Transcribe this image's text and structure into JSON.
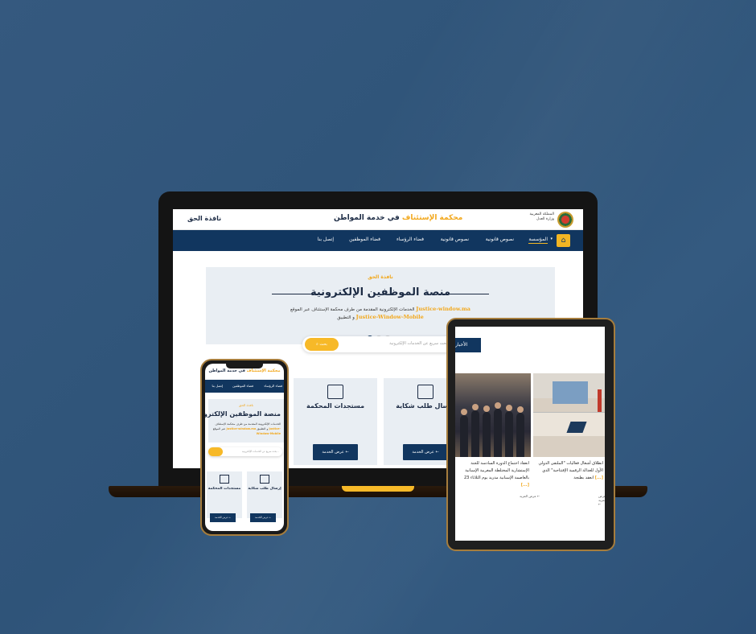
{
  "laptop": {
    "header": {
      "brand_left": "نافذة الحق",
      "brand_center_highlight": "محكمة الإستئناف",
      "brand_center_rest": " في خدمة المواطن",
      "emblem_text": "المملكة المغربية وزارة العدل"
    },
    "nav": {
      "items": [
        "المؤسسة",
        "نصوص قانونية",
        "نصوص قانونية",
        "فضاء الرؤساء",
        "فضاء الموظفين",
        "إتصل بنا"
      ]
    },
    "hero": {
      "kicker": "نافذة الحق",
      "title": "منصة الموظفين الإلكترونية",
      "desc_line1": "الخدمات الإلكترونية المقدمة من طرف محكمة الإستئناف عبر الموقع",
      "site": "Justice-window.ma",
      "desc_and": "و التطبيق",
      "app": "Justice-Window-Mobile"
    },
    "search": {
      "button": "بحث",
      "placeholder": "بحث سريع عن الخدمات الإلكترونية..."
    },
    "cards": [
      {
        "title": "إرسال طلب شكاية",
        "button": "عرض الخدمة ←"
      },
      {
        "title": "مستجدات المحكمة",
        "button": "عرض الخدمة ←"
      }
    ]
  },
  "phone": {
    "header_highlight": "محكمة الإستئناف",
    "header_rest": " في خدمة المواطن",
    "nav": [
      "فضاء الرؤساء",
      "فضاء الموظفين",
      "إتصل بنا"
    ],
    "hero": {
      "kicker": "نافذة الحق",
      "title": "منصة الموظفين الإلكترونية",
      "desc": "الخدمات الإلكترونية المقدمة من طرف محكمة الإستئناف عبر الموقع",
      "site": "Justice-window.ma",
      "desc_and": "و التطبيق",
      "app": "Justice-Window-Mobile"
    },
    "search_placeholder": "بحث سريع عن الخدمات الإلكترونية...",
    "cards": [
      {
        "title": "إرسال طلب شكاية",
        "button": "عرض الخدمة ←"
      },
      {
        "title": "مستجدات المحكمة",
        "button": "عرض الخدمة ←"
      }
    ]
  },
  "tablet": {
    "tag": "الأخبار",
    "news": [
      {
        "text": "انعقاد اجتماع الدورة السادسة للجنة الإستشارية المختلطة المغربية الإسبانية بالعاصمة الإسبانية مدريد يوم الثلاثاء 23",
        "more_link": "[...]",
        "read": "عرض المزيد ←"
      },
      {
        "text": "انطلاق أشغال فعاليات \"الملتقى الدولي الأول للعدالة الرقمية الإفتتاحية\" الذي انعقد بطنجة",
        "more_link": "[...]",
        "read": "عرض المزيد ←"
      }
    ]
  },
  "colors": {
    "navy": "#11365f",
    "accent": "#f2b523",
    "background": "#2f5479"
  }
}
